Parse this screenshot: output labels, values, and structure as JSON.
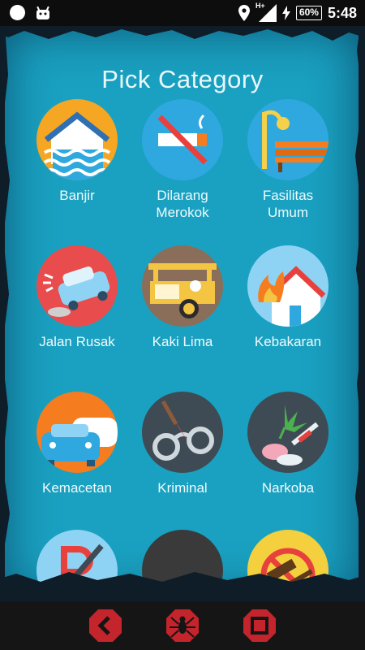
{
  "status_bar": {
    "network": "H+",
    "battery": "60%",
    "time": "5:48",
    "icons": [
      "circle-icon",
      "android-icon",
      "location-icon",
      "signal-icon",
      "charging-icon",
      "battery-icon"
    ]
  },
  "page": {
    "title": "Pick Category"
  },
  "categories": [
    {
      "label": "Banjir",
      "icon": "flood-icon"
    },
    {
      "label": "Dilarang\nMerokok",
      "icon": "no-smoking-icon"
    },
    {
      "label": "Fasilitas\nUmum",
      "icon": "public-facility-icon"
    },
    {
      "label": "Jalan Rusak",
      "icon": "damaged-road-icon"
    },
    {
      "label": "Kaki Lima",
      "icon": "street-vendor-icon"
    },
    {
      "label": "Kebakaran",
      "icon": "fire-icon"
    },
    {
      "label": "Kemacetan",
      "icon": "traffic-jam-icon"
    },
    {
      "label": "Kriminal",
      "icon": "crime-icon"
    },
    {
      "label": "Narkoba",
      "icon": "drugs-icon"
    },
    {
      "label": "",
      "icon": "no-parking-icon"
    },
    {
      "label": "",
      "icon": "dark-category-icon"
    },
    {
      "label": "",
      "icon": "no-gambling-icon"
    }
  ],
  "nav": {
    "icons": [
      "back-icon",
      "spider-icon",
      "stop-icon"
    ]
  },
  "colors": {
    "board": "#1aa1c1",
    "nav_accent": "#c4242b"
  }
}
